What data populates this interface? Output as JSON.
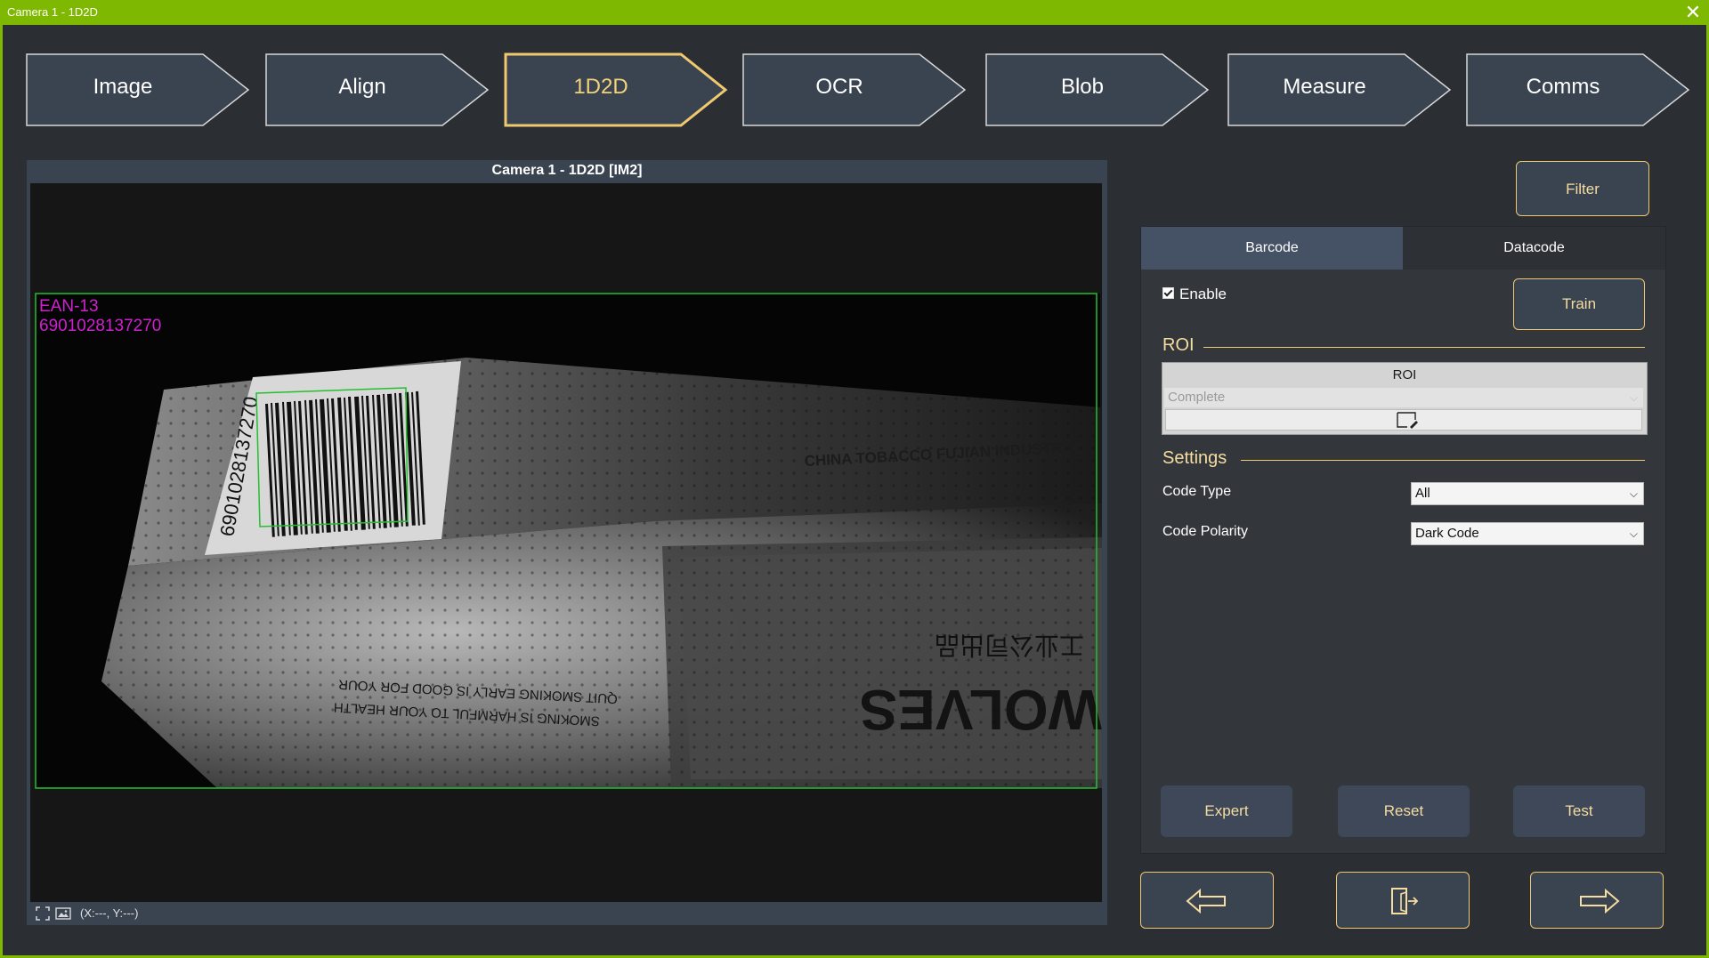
{
  "window": {
    "title": "Camera 1 - 1D2D"
  },
  "steps": [
    {
      "label": "Image",
      "active": false
    },
    {
      "label": "Align",
      "active": false
    },
    {
      "label": "1D2D",
      "active": true
    },
    {
      "label": "OCR",
      "active": false
    },
    {
      "label": "Blob",
      "active": false
    },
    {
      "label": "Measure",
      "active": false
    },
    {
      "label": "Comms",
      "active": false
    }
  ],
  "viewer": {
    "title": "Camera 1 - 1D2D  [IM2]",
    "result_type": "EAN-13",
    "result_value": "6901028137270",
    "photo_text": {
      "label_digits": "6901028137270",
      "brand": "CHINA TOBACCO FUJIAN INDUSTR",
      "warning_line1": "QUIT SMOKING EARLY IS GOOD FOR YOUR",
      "warning_line2": "SMOKING IS HARMFUL TO YOUR HEALTH",
      "wordmark": "WOLVES",
      "chinese": "工业公司出品"
    },
    "status": {
      "coords": "(X:---, Y:---)",
      "fit_icon": "fit-screen-icon",
      "image_icon": "image-icon"
    }
  },
  "right_panel": {
    "filter_label": "Filter",
    "tabs": [
      {
        "label": "Barcode",
        "active": true
      },
      {
        "label": "Datacode",
        "active": false
      }
    ],
    "enable_label": "Enable",
    "enable_checked": true,
    "train_label": "Train",
    "roi_section": "ROI",
    "roi_header": "ROI",
    "roi_mode": "Complete",
    "roi_edit_icon": "roi-edit-icon",
    "settings_section": "Settings",
    "code_type_label": "Code Type",
    "code_type_value": "All",
    "code_polarity_label": "Code Polarity",
    "code_polarity_value": "Dark Code",
    "expert_label": "Expert",
    "reset_label": "Reset",
    "test_label": "Test"
  },
  "nav": {
    "back_icon": "arrow-left-icon",
    "exit_icon": "exit-door-icon",
    "next_icon": "arrow-right-icon"
  },
  "colors": {
    "titlebar": "#7fb800",
    "accent": "#f0c86e",
    "step_fill": "#3a4350",
    "detection_box": "#22c030",
    "result_text": "#d020d0"
  }
}
